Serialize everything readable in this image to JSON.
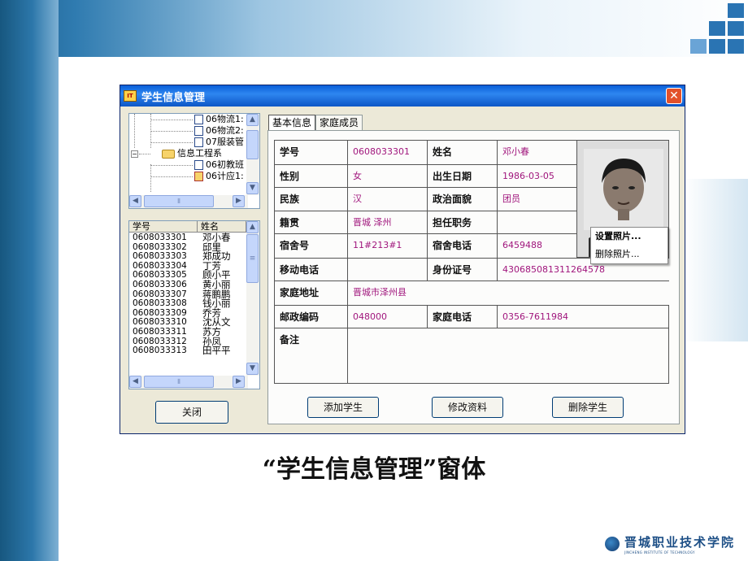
{
  "slide": {
    "caption": "“学生信息管理”窗体",
    "logo_text": "晋城职业技术学院",
    "logo_subtext": "JINCHENG INSTITUTE OF TECHNOLOGY",
    "colors": {
      "accent": "#2a74b3",
      "value_text": "#a0157c"
    }
  },
  "window": {
    "icon_label": "IT",
    "title": "学生信息管理",
    "close_symbol": "✕"
  },
  "tree": {
    "items": [
      {
        "label": "06物流1:",
        "icon": "document-icon"
      },
      {
        "label": "06物流2:",
        "icon": "document-icon"
      },
      {
        "label": "07服装管",
        "icon": "document-icon"
      },
      {
        "label": "信息工程系",
        "icon": "folder-open-icon",
        "toggle": "−"
      },
      {
        "label": "06初教班",
        "icon": "document-icon"
      },
      {
        "label": "06计应1:",
        "icon": "document-edit-icon"
      }
    ]
  },
  "scroll_glyphs": {
    "up": "▲",
    "down": "▼",
    "left": "◀",
    "right": "▶",
    "grip": "≡",
    "hgrip": "⦀"
  },
  "student_list": {
    "columns": [
      "学号",
      "姓名"
    ],
    "rows": [
      [
        "0608033301",
        "邓小春"
      ],
      [
        "0608033302",
        "邱里"
      ],
      [
        "0608033303",
        "郑成功"
      ],
      [
        "0608033304",
        "丁芳"
      ],
      [
        "0608033305",
        "顾小平"
      ],
      [
        "0608033306",
        "黄小丽"
      ],
      [
        "0608033307",
        "蒋鹏鹏"
      ],
      [
        "0608033308",
        "钱小丽"
      ],
      [
        "0608033309",
        "乔芳"
      ],
      [
        "0608033310",
        "沈从文"
      ],
      [
        "0608033311",
        "苏方"
      ],
      [
        "0608033312",
        "孙凤"
      ],
      [
        "0608033313",
        "田平平"
      ]
    ]
  },
  "close_button_label": "关闭",
  "tabs": [
    "基本信息",
    "家庭成员"
  ],
  "form": {
    "student_no_label": "学号",
    "student_no": "0608033301",
    "name_label": "姓名",
    "name": "邓小春",
    "gender_label": "性别",
    "gender": "女",
    "birth_label": "出生日期",
    "birth": "1986-03-05",
    "ethnic_label": "民族",
    "ethnic": "汉",
    "political_label": "政治面貌",
    "political": "团员",
    "native_label": "籍贯",
    "native": "晋城 泽州",
    "duty_label": "担任职务",
    "duty": "",
    "dorm_label": "宿舍号",
    "dorm": "11#213#1",
    "dorm_phone_label": "宿舍电话",
    "dorm_phone": "6459488",
    "mobile_label": "移动电话",
    "mobile": "",
    "id_label": "身份证号",
    "id_no": "430685081311264578",
    "address_label": "家庭地址",
    "address": "晋城市泽州县",
    "postcode_label": "邮政编码",
    "postcode": "048000",
    "home_phone_label": "家庭电话",
    "home_phone": "0356-7611984",
    "remark_label": "备注",
    "remark": ""
  },
  "context_menu": [
    "设置照片...",
    "删除照片..."
  ],
  "actions": {
    "add": "添加学生",
    "edit": "修改资料",
    "delete": "删除学生"
  }
}
